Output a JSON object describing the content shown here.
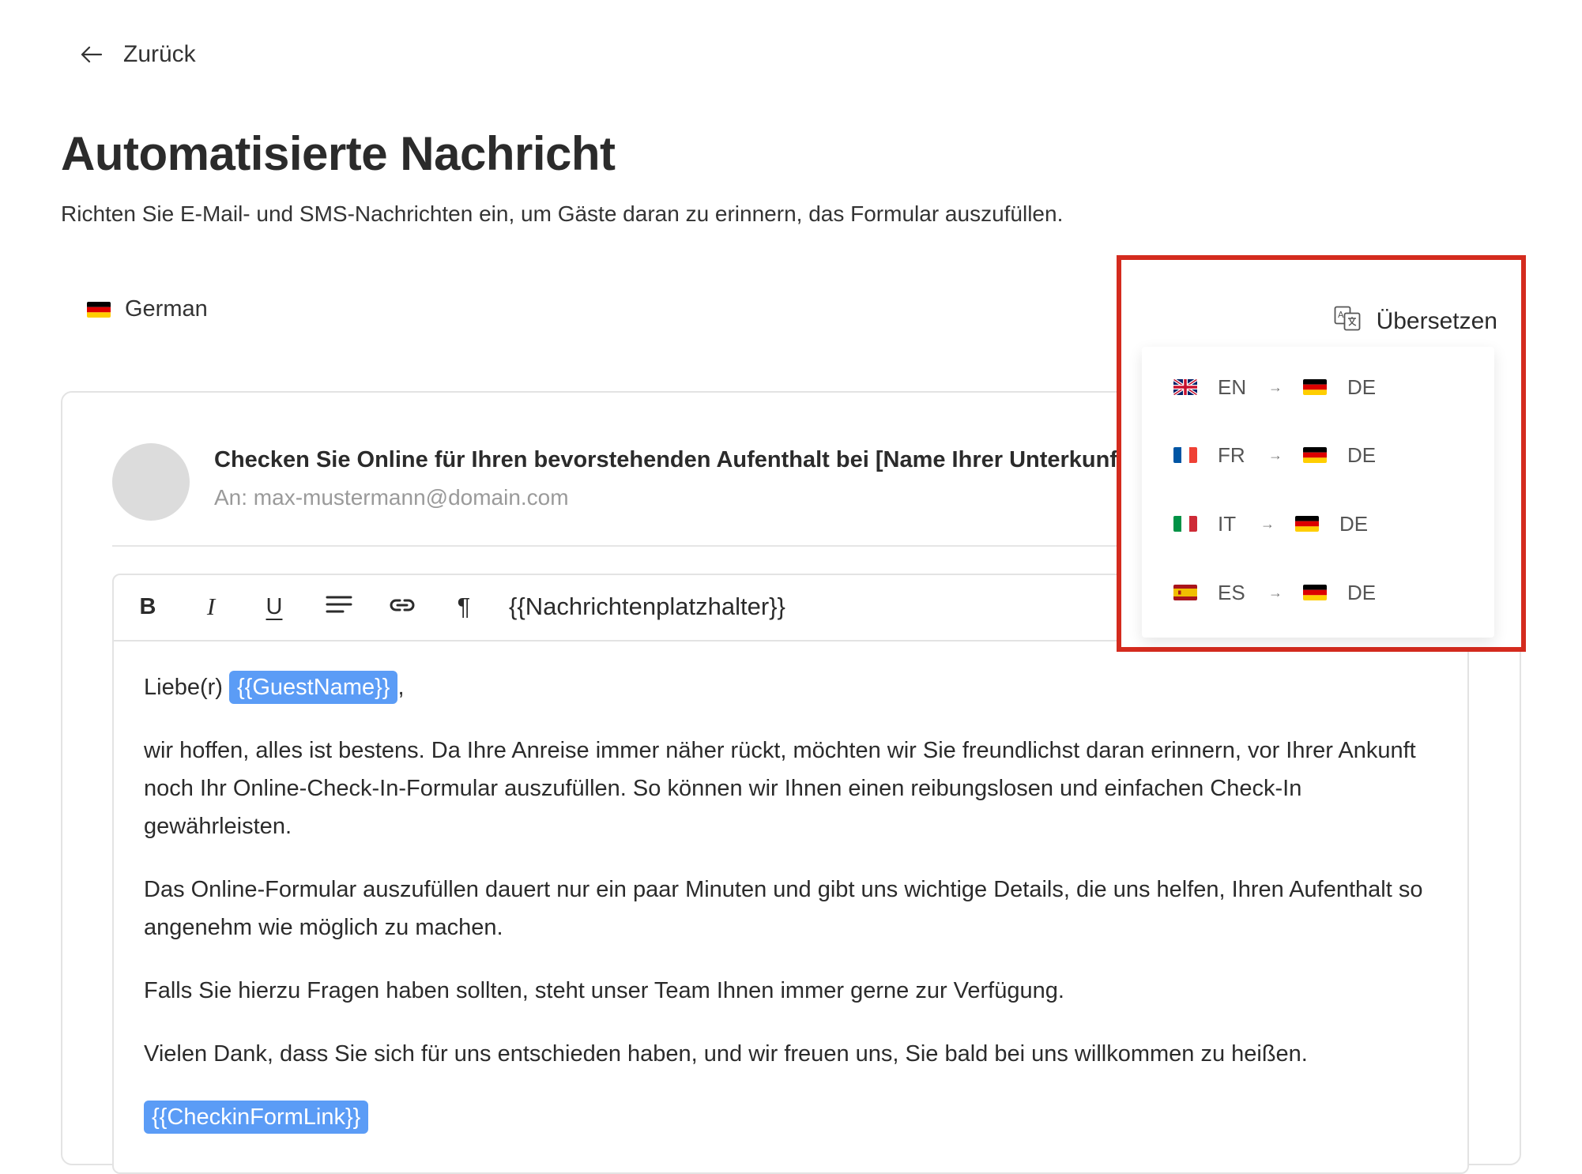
{
  "nav": {
    "back_label": "Zurück"
  },
  "page": {
    "title": "Automatisierte Nachricht",
    "subtitle": "Richten Sie E-Mail- und SMS-Nachrichten ein, um Gäste daran zu erinnern, das Formular auszufüllen."
  },
  "language_select": {
    "value": "German",
    "flag": "de-flag"
  },
  "email": {
    "subject": "Checken Sie Online für Ihren bevorstehenden Aufenthalt bei [Name Ihrer Unterkunft]",
    "recipient": "An: max-mustermann@domain.com"
  },
  "toolbar": {
    "bold": "B",
    "italic": "I",
    "underline": "U",
    "align_icon": "align-left-icon",
    "link_icon": "link-icon",
    "paragraph": "¶",
    "placeholder_label": "{{Nachrichtenplatzhalter}}"
  },
  "body": {
    "greeting_prefix": "Liebe(r)",
    "greeting_tag": "{{GuestName}}",
    "greeting_suffix": ",",
    "paragraph1": "wir hoffen, alles ist bestens. Da Ihre Anreise immer näher rückt, möchten wir Sie freundlichst daran erinnern, vor Ihrer Ankunft noch Ihr Online-Check-In-Formular auszufüllen. So können wir Ihnen einen reibungslosen und einfachen Check-In gewährleisten.",
    "paragraph2": "Das Online-Formular auszufüllen dauert nur ein paar Minuten und gibt uns wichtige Details, die uns helfen, Ihren Aufenthalt so angenehm wie möglich zu machen.",
    "paragraph3": "Falls Sie hierzu Fragen haben sollten, steht unser Team Ihnen immer gerne zur Verfügung.",
    "paragraph4": "Vielen Dank, dass Sie sich für uns entschieden haben, und wir freuen uns, Sie bald bei uns willkommen zu heißen.",
    "link_tag": "{{CheckinFormLink}}"
  },
  "translate": {
    "label": "Übersetzen",
    "icon": "translate-icon",
    "options": [
      {
        "from": "EN",
        "to": "DE",
        "from_flag": "gb-flag",
        "to_flag": "de-flag"
      },
      {
        "from": "FR",
        "to": "DE",
        "from_flag": "fr-flag",
        "to_flag": "de-flag"
      },
      {
        "from": "IT",
        "to": "DE",
        "from_flag": "it-flag",
        "to_flag": "de-flag"
      },
      {
        "from": "ES",
        "to": "DE",
        "from_flag": "es-flag",
        "to_flag": "de-flag"
      }
    ]
  },
  "colors": {
    "highlight_border": "#d42b1e",
    "tag_background": "#5b9cf6",
    "avatar": "#dcdcdc"
  }
}
